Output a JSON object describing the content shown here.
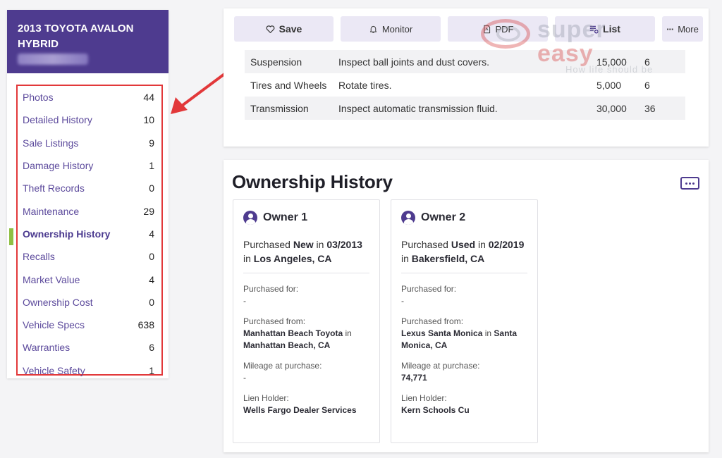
{
  "vehicle": {
    "title": "2013 TOYOTA AVALON HYBRID"
  },
  "sidebar": {
    "items": [
      {
        "label": "Photos",
        "count": "44"
      },
      {
        "label": "Detailed History",
        "count": "10"
      },
      {
        "label": "Sale Listings",
        "count": "9"
      },
      {
        "label": "Damage History",
        "count": "1"
      },
      {
        "label": "Theft Records",
        "count": "0"
      },
      {
        "label": "Maintenance",
        "count": "29"
      },
      {
        "label": "Ownership History",
        "count": "4",
        "active": true
      },
      {
        "label": "Recalls",
        "count": "0"
      },
      {
        "label": "Market Value",
        "count": "4"
      },
      {
        "label": "Ownership Cost",
        "count": "0"
      },
      {
        "label": "Vehicle Specs",
        "count": "638"
      },
      {
        "label": "Warranties",
        "count": "6"
      },
      {
        "label": "Vehicle Safety",
        "count": "1"
      }
    ]
  },
  "toolbar": {
    "save": "Save",
    "monitor": "Monitor",
    "pdf": "PDF",
    "list": "List",
    "more": "More"
  },
  "maintenance": {
    "rows": [
      {
        "system": "Suspension",
        "task": "Inspect ball joints and dust covers.",
        "miles": "15,000",
        "months": "6"
      },
      {
        "system": "Tires and Wheels",
        "task": "Rotate tires.",
        "miles": "5,000",
        "months": "6"
      },
      {
        "system": "Transmission",
        "task": "Inspect automatic transmission fluid.",
        "miles": "30,000",
        "months": "36"
      }
    ]
  },
  "watermark": {
    "brand_a": "super",
    "brand_b": "easy",
    "tagline": "How life should be"
  },
  "ownership": {
    "title": "Ownership History",
    "owners": [
      {
        "name": "Owner 1",
        "purchased_word": "Purchased",
        "condition": "New",
        "in_word": "in",
        "date": "03/2013",
        "location": "Los Angeles, CA",
        "purchased_for_label": "Purchased for:",
        "purchased_for": "-",
        "purchased_from_label": "Purchased from:",
        "dealer": "Manhattan Beach Toyota",
        "dealer_city": "Manhattan Beach, CA",
        "mileage_label": "Mileage at purchase:",
        "mileage": "-",
        "lien_label": "Lien Holder:",
        "lien": "Wells Fargo Dealer Services"
      },
      {
        "name": "Owner 2",
        "purchased_word": "Purchased",
        "condition": "Used",
        "in_word": "in",
        "date": "02/2019",
        "location": "Bakersfield, CA",
        "purchased_for_label": "Purchased for:",
        "purchased_for": "-",
        "purchased_from_label": "Purchased from:",
        "dealer": "Lexus Santa Monica",
        "dealer_city": "Santa Monica, CA",
        "mileage_label": "Mileage at purchase:",
        "mileage": "74,771",
        "lien_label": "Lien Holder:",
        "lien": "Kern Schools Cu"
      }
    ]
  },
  "colors": {
    "brand": "#4e3b8f",
    "highlight": "#e2383a",
    "active_marker": "#8fbf44"
  }
}
